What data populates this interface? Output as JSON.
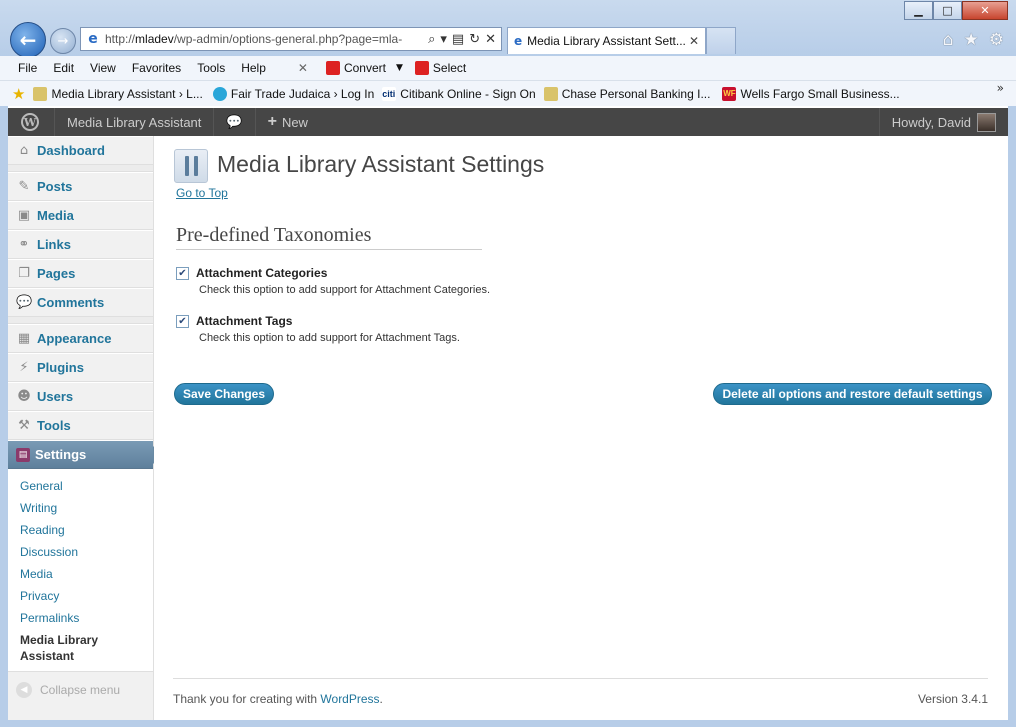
{
  "browser": {
    "address_url_prefix": "http://",
    "address_url_host": "mladev",
    "address_url_path": "/wp-admin/options-general.php?page=mla-",
    "tab_title": "Media Library Assistant Sett...",
    "menu": [
      "File",
      "Edit",
      "View",
      "Favorites",
      "Tools",
      "Help"
    ],
    "convert_label": "Convert",
    "select_label": "Select",
    "favorites": [
      "Media Library Assistant › L...",
      "Fair Trade Judaica › Log In",
      "Citibank Online - Sign On",
      "Chase Personal Banking I...",
      "Wells Fargo Small Business..."
    ]
  },
  "adminbar": {
    "site_name": "Media Library Assistant",
    "new_label": "New",
    "howdy": "Howdy, David"
  },
  "sidebar": {
    "dashboard": "Dashboard",
    "posts": "Posts",
    "media": "Media",
    "links": "Links",
    "pages": "Pages",
    "comments": "Comments",
    "appearance": "Appearance",
    "plugins": "Plugins",
    "users": "Users",
    "tools": "Tools",
    "settings": "Settings",
    "submenu": [
      "General",
      "Writing",
      "Reading",
      "Discussion",
      "Media",
      "Privacy",
      "Permalinks",
      "Media Library Assistant"
    ],
    "collapse": "Collapse menu"
  },
  "main": {
    "title": "Media Library Assistant Settings",
    "go_to_top": "Go to Top",
    "section_title": "Pre-defined Taxonomies",
    "options": [
      {
        "label": "Attachment Categories",
        "desc": "Check this option to add support for Attachment Categories.",
        "checked": true
      },
      {
        "label": "Attachment Tags",
        "desc": "Check this option to add support for Attachment Tags.",
        "checked": true
      }
    ],
    "save_button": "Save Changes",
    "restore_button": "Delete all options and restore default settings",
    "footer_text": "Thank you for creating with ",
    "footer_link": "WordPress",
    "footer_period": ".",
    "version": "Version 3.4.1"
  }
}
